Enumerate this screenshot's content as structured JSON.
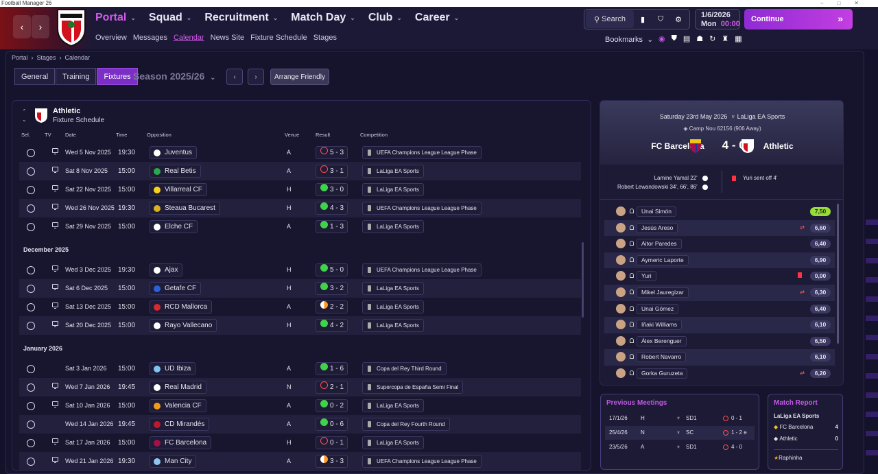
{
  "window": {
    "title": "Football Manager 26"
  },
  "nav": {
    "menu": [
      {
        "label": "Portal",
        "active": true
      },
      {
        "label": "Squad",
        "active": false
      },
      {
        "label": "Recruitment",
        "active": false
      },
      {
        "label": "Match Day",
        "active": false
      },
      {
        "label": "Club",
        "active": false
      },
      {
        "label": "Career",
        "active": false
      }
    ],
    "submenu": [
      {
        "label": "Overview",
        "active": false
      },
      {
        "label": "Messages",
        "active": false
      },
      {
        "label": "Calendar",
        "active": true
      },
      {
        "label": "News Site",
        "active": false
      },
      {
        "label": "Fixture Schedule",
        "active": false
      },
      {
        "label": "Stages",
        "active": false
      }
    ],
    "search_label": "Search",
    "date": "1/6/2026",
    "day": "Mon",
    "time": "00:00",
    "continue_label": "Continue",
    "bookmarks_label": "Bookmarks"
  },
  "breadcrumb": {
    "items": [
      "Portal",
      "Stages",
      "Calendar"
    ]
  },
  "tabs": [
    {
      "label": "General",
      "active": false
    },
    {
      "label": "Training",
      "active": false
    },
    {
      "label": "Fixtures",
      "active": true
    }
  ],
  "season": "Season 2025/26",
  "arrange_friendly": "Arrange Friendly",
  "schedule": {
    "team": "Athletic",
    "subtitle": "Fixture Schedule",
    "columns": [
      "Sel.",
      "TV",
      "Date",
      "Time",
      "Opposition",
      "Venue",
      "Result",
      "Competition"
    ],
    "rows": [
      {
        "type": "fixture",
        "tv": true,
        "date": "Wed 5 Nov 2025",
        "time": "19:30",
        "opp": "Juventus",
        "venue": "A",
        "res": "L",
        "score": "5 - 3",
        "comp": "UEFA Champions League League Phase",
        "col": "#ffffff"
      },
      {
        "type": "fixture",
        "tv": true,
        "date": "Sat 8 Nov 2025",
        "time": "15:00",
        "opp": "Real Betis",
        "venue": "A",
        "res": "L",
        "score": "3 - 1",
        "comp": "LaLiga EA Sports",
        "col": "#2aa84a"
      },
      {
        "type": "fixture",
        "tv": true,
        "date": "Sat 22 Nov 2025",
        "time": "15:00",
        "opp": "Villarreal CF",
        "venue": "H",
        "res": "W",
        "score": "3 - 0",
        "comp": "LaLiga EA Sports",
        "col": "#f5d01c"
      },
      {
        "type": "fixture",
        "tv": true,
        "date": "Wed 26 Nov 2025",
        "time": "19:30",
        "opp": "Steaua Bucarest",
        "venue": "H",
        "res": "W",
        "score": "4 - 3",
        "comp": "UEFA Champions League League Phase",
        "col": "#d9b020"
      },
      {
        "type": "fixture",
        "tv": true,
        "date": "Sat 29 Nov 2025",
        "time": "15:00",
        "opp": "Elche CF",
        "venue": "A",
        "res": "W",
        "score": "1 - 3",
        "comp": "LaLiga EA Sports",
        "col": "#ffffff"
      },
      {
        "type": "month",
        "label": "December 2025"
      },
      {
        "type": "fixture",
        "tv": true,
        "date": "Wed 3 Dec 2025",
        "time": "19:30",
        "opp": "Ajax",
        "venue": "H",
        "res": "W",
        "score": "5 - 0",
        "comp": "UEFA Champions League League Phase",
        "col": "#ffffff"
      },
      {
        "type": "fixture",
        "tv": true,
        "date": "Sat 6 Dec 2025",
        "time": "15:00",
        "opp": "Getafe CF",
        "venue": "H",
        "res": "W",
        "score": "3 - 2",
        "comp": "LaLiga EA Sports",
        "col": "#2a5fd9"
      },
      {
        "type": "fixture",
        "tv": true,
        "date": "Sat 13 Dec 2025",
        "time": "15:00",
        "opp": "RCD Mallorca",
        "venue": "A",
        "res": "D",
        "score": "2 - 2",
        "comp": "LaLiga EA Sports",
        "col": "#d9282e"
      },
      {
        "type": "fixture",
        "tv": true,
        "date": "Sat 20 Dec 2025",
        "time": "15:00",
        "opp": "Rayo Vallecano",
        "venue": "H",
        "res": "W",
        "score": "4 - 2",
        "comp": "LaLiga EA Sports",
        "col": "#ffffff"
      },
      {
        "type": "month",
        "label": "January 2026"
      },
      {
        "type": "fixture",
        "tv": false,
        "date": "Sat 3 Jan 2026",
        "time": "15:00",
        "opp": "UD Ibiza",
        "venue": "A",
        "res": "W",
        "score": "1 - 6",
        "comp": "Copa del Rey Third Round",
        "col": "#7fc3f0"
      },
      {
        "type": "fixture",
        "tv": true,
        "date": "Wed 7 Jan 2026",
        "time": "19:45",
        "opp": "Real Madrid",
        "venue": "N",
        "res": "L",
        "score": "2 - 1",
        "comp": "Supercopa de España Semi Final",
        "col": "#ffffff"
      },
      {
        "type": "fixture",
        "tv": true,
        "date": "Sat 10 Jan 2026",
        "time": "15:00",
        "opp": "Valencia CF",
        "venue": "A",
        "res": "W",
        "score": "0 - 2",
        "comp": "LaLiga EA Sports",
        "col": "#f29a1a"
      },
      {
        "type": "fixture",
        "tv": false,
        "date": "Wed 14 Jan 2026",
        "time": "19:45",
        "opp": "CD Mirandés",
        "venue": "A",
        "res": "W",
        "score": "0 - 6",
        "comp": "Copa del Rey Fourth Round",
        "col": "#c4162b"
      },
      {
        "type": "fixture",
        "tv": true,
        "date": "Sat 17 Jan 2026",
        "time": "15:00",
        "opp": "FC Barcelona",
        "venue": "H",
        "res": "L",
        "score": "0 - 1",
        "comp": "LaLiga EA Sports",
        "col": "#a4104a"
      },
      {
        "type": "fixture",
        "tv": true,
        "date": "Wed 21 Jan 2026",
        "time": "19:30",
        "opp": "Man City",
        "venue": "A",
        "res": "D",
        "score": "3 - 3",
        "comp": "UEFA Champions League League Phase",
        "col": "#8ec6ef"
      }
    ]
  },
  "match": {
    "date": "Saturday 23rd May 2026",
    "competition": "LaLiga EA Sports",
    "venue": "Camp Nou",
    "attendance": "62156 (906 Away)",
    "home": "FC Barcelona",
    "away": "Athletic",
    "score": "4 - 0",
    "scorers": [
      "Lamine Yamal 22'",
      "Robert Lewandowski 34', 66', 86'"
    ],
    "cards": [
      "Yuri sent off 4'"
    ],
    "lineup": [
      {
        "name": "Unai Simón",
        "rating": "7,50",
        "best": true,
        "event": ""
      },
      {
        "name": "Jesús Areso",
        "rating": "6,60",
        "best": false,
        "event": "sub"
      },
      {
        "name": "Aitor Paredes",
        "rating": "6,40",
        "best": false,
        "event": ""
      },
      {
        "name": "Aymeric Laporte",
        "rating": "6,90",
        "best": false,
        "event": ""
      },
      {
        "name": "Yuri",
        "rating": "0,00",
        "best": false,
        "event": "red"
      },
      {
        "name": "Mikel Jauregizar",
        "rating": "6,30",
        "best": false,
        "event": "sub"
      },
      {
        "name": "Unai Gómez",
        "rating": "6,40",
        "best": false,
        "event": ""
      },
      {
        "name": "Iñaki Williams",
        "rating": "6,10",
        "best": false,
        "event": ""
      },
      {
        "name": "Álex Berenguer",
        "rating": "6,50",
        "best": false,
        "event": ""
      },
      {
        "name": "Robert Navarro",
        "rating": "6,10",
        "best": false,
        "event": ""
      },
      {
        "name": "Gorka Guruzeta",
        "rating": "6,20",
        "best": false,
        "event": "sub"
      }
    ]
  },
  "meetings": {
    "title": "Previous Meetings",
    "rows": [
      {
        "date": "17/1/26",
        "venue": "H",
        "comp": "SD1",
        "score": "0 - 1"
      },
      {
        "date": "25/4/26",
        "venue": "N",
        "comp": "SC",
        "score": "1 - 2 e"
      },
      {
        "date": "23/5/26",
        "venue": "A",
        "comp": "SD1",
        "score": "4 - 0"
      }
    ]
  },
  "report": {
    "title": "Match Report",
    "competition": "LaLiga EA Sports",
    "home": "FC Barcelona",
    "home_goals": "4",
    "away": "Athletic",
    "away_goals": "0",
    "potm": "Raphinha"
  },
  "colors": {
    "accent": "#d25ae8",
    "win": "#3fd24a",
    "loss": "#ff4d4d",
    "best_rating": "#9adb3c"
  }
}
